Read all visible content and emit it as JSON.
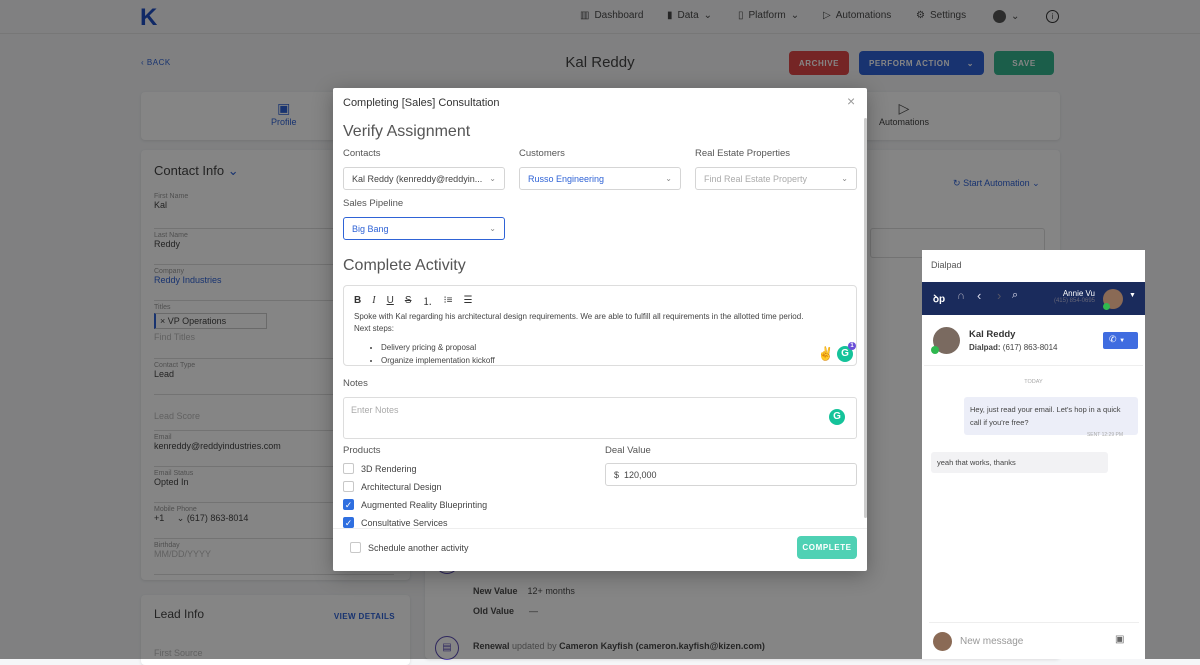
{
  "nav": {
    "logo": "K",
    "items": [
      {
        "label": "Dashboard",
        "icon": "chart-icon"
      },
      {
        "label": "Data",
        "icon": "database-icon"
      },
      {
        "label": "Platform",
        "icon": "platform-icon"
      },
      {
        "label": "Automations",
        "icon": "play-icon"
      },
      {
        "label": "Settings",
        "icon": "gear-icon"
      }
    ]
  },
  "header": {
    "back": "BACK",
    "title": "Kal Reddy",
    "archive": "ARCHIVE",
    "perform_action": "PERFORM ACTION",
    "save": "SAVE"
  },
  "tabs": [
    {
      "label": "Profile"
    },
    {
      "label": "Automations"
    }
  ],
  "contact": {
    "title": "Contact Info",
    "fields": [
      {
        "label": "First Name",
        "value": "Kal"
      },
      {
        "label": "Last Name",
        "value": "Reddy"
      },
      {
        "label": "Company",
        "value": "Reddy Industries"
      },
      {
        "label": "Titles",
        "value": "VP Operations",
        "placeholder": "Find Titles"
      },
      {
        "label": "Contact Type",
        "value": "Lead"
      },
      {
        "label": "",
        "value": "",
        "placeholder": "Lead Score"
      },
      {
        "label": "Email",
        "value": "kenreddy@reddyindustries.com"
      },
      {
        "label": "Email Status",
        "value": "Opted In"
      },
      {
        "label": "Mobile Phone",
        "country": "+1",
        "value": "(617) 863-8014"
      },
      {
        "label": "Birthday",
        "placeholder": "MM/DD/YYYY"
      }
    ]
  },
  "lead": {
    "title": "Lead Info",
    "view_details": "VIEW DETAILS",
    "first_source": "First Source"
  },
  "timeline": {
    "start_automation": "Start Automation",
    "new_value_label": "New Value",
    "new_value": "12+ months",
    "old_value_label": "Old Value",
    "old_value": "—",
    "renewal_field": "Renewal",
    "updated_by": "updated by",
    "user": "Cameron Kayfish (cameron.kayfish@kizen.com)"
  },
  "modal": {
    "title": "Completing [Sales] Consultation",
    "verify": "Verify Assignment",
    "contacts_label": "Contacts",
    "contacts_value": "Kal Reddy (kenreddy@reddyin...",
    "customers_label": "Customers",
    "customers_value": "Russo Engineering",
    "real_estate_label": "Real Estate Properties",
    "real_estate_placeholder": "Find Real Estate Property",
    "pipeline_label": "Sales Pipeline",
    "pipeline_value": "Big Bang",
    "complete_activity": "Complete Activity",
    "editor_text": "Spoke with Kal regarding his architectural design requirements. We are able to fulfill all requirements in the allotted time period.",
    "next_steps": "Next steps:",
    "bullets": [
      "Delivery pricing & proposal",
      "Organize implementation kickoff"
    ],
    "grammarly_count": "1",
    "notes_label": "Notes",
    "notes_placeholder": "Enter Notes",
    "products_label": "Products",
    "products": [
      {
        "label": "3D Rendering",
        "checked": false
      },
      {
        "label": "Architectural Design",
        "checked": false
      },
      {
        "label": "Augmented Reality Blueprinting",
        "checked": true
      },
      {
        "label": "Consultative Services",
        "checked": true
      }
    ],
    "deal_label": "Deal Value",
    "deal_currency": "$",
    "deal_value": "120,000",
    "schedule": "Schedule another activity",
    "complete": "COMPLETE"
  },
  "dialpad": {
    "title": "Dialpad",
    "user_name": "Annie Vu",
    "user_phone": "(415) 854-0695",
    "contact_name": "Kal Reddy",
    "contact_label": "Dialpad:",
    "contact_phone": "(617) 863-8014",
    "today": "TODAY",
    "msg_out": "Hey, just read your email. Let's hop in a quick call if you're free?",
    "sent": "SENT 12:29 PM",
    "msg_in": "yeah that works, thanks",
    "placeholder": "New message"
  },
  "colors": {
    "brand": "#1f4fc4",
    "archive": "#e04848",
    "perform": "#2f63d6",
    "save": "#35b48f",
    "complete": "#4fd1b4",
    "dialpad_nav": "#1a2b5c"
  }
}
